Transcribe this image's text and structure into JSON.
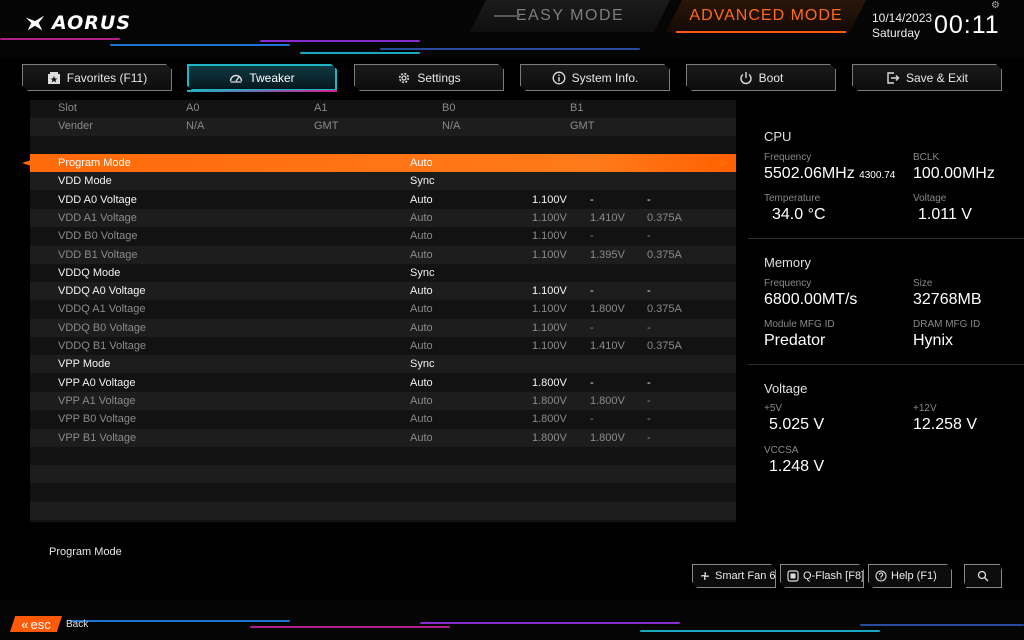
{
  "header": {
    "brand": "AORUS",
    "easy_mode": "EASY MODE",
    "advanced_mode": "ADVANCED MODE",
    "date": "10/14/2023",
    "day": "Saturday",
    "time": "00:11"
  },
  "tabs": [
    {
      "label": "Favorites (F11)",
      "icon": "favorites-icon"
    },
    {
      "label": "Tweaker",
      "icon": "gauge-icon",
      "active": true
    },
    {
      "label": "Settings",
      "icon": "gear-icon"
    },
    {
      "label": "System Info.",
      "icon": "info-icon"
    },
    {
      "label": "Boot",
      "icon": "power-icon"
    },
    {
      "label": "Save & Exit",
      "icon": "exit-icon"
    }
  ],
  "slot_table": {
    "slot": {
      "label": "Slot",
      "values": [
        "A0",
        "A1",
        "B0",
        "B1"
      ]
    },
    "vender": {
      "label": "Vender",
      "values": [
        "N/A",
        "GMT",
        "N/A",
        "GMT"
      ]
    }
  },
  "settings": [
    {
      "name": "Program Mode",
      "value": "Auto",
      "v1": "",
      "v2": "",
      "v3": "",
      "style": "selected"
    },
    {
      "name": "VDD Mode",
      "value": "Sync",
      "v1": "",
      "v2": "",
      "v3": "",
      "style": "bright"
    },
    {
      "name": "VDD A0 Voltage",
      "value": "Auto",
      "v1": "1.100V",
      "v2": "-",
      "v3": "-",
      "style": "bright"
    },
    {
      "name": "VDD A1 Voltage",
      "value": "Auto",
      "v1": "1.100V",
      "v2": "1.410V",
      "v3": "0.375A",
      "style": "dim"
    },
    {
      "name": "VDD B0 Voltage",
      "value": "Auto",
      "v1": "1.100V",
      "v2": "-",
      "v3": "-",
      "style": "dim"
    },
    {
      "name": "VDD B1 Voltage",
      "value": "Auto",
      "v1": "1.100V",
      "v2": "1.395V",
      "v3": "0.375A",
      "style": "dim"
    },
    {
      "name": "VDDQ Mode",
      "value": "Sync",
      "v1": "",
      "v2": "",
      "v3": "",
      "style": "bright"
    },
    {
      "name": "VDDQ A0 Voltage",
      "value": "Auto",
      "v1": "1.100V",
      "v2": "-",
      "v3": "-",
      "style": "bright"
    },
    {
      "name": "VDDQ A1 Voltage",
      "value": "Auto",
      "v1": "1.100V",
      "v2": "1.800V",
      "v3": "0.375A",
      "style": "dim"
    },
    {
      "name": "VDDQ B0 Voltage",
      "value": "Auto",
      "v1": "1.100V",
      "v2": "-",
      "v3": "-",
      "style": "dim"
    },
    {
      "name": "VDDQ B1 Voltage",
      "value": "Auto",
      "v1": "1.100V",
      "v2": "1.410V",
      "v3": "0.375A",
      "style": "dim"
    },
    {
      "name": "VPP Mode",
      "value": "Sync",
      "v1": "",
      "v2": "",
      "v3": "",
      "style": "bright"
    },
    {
      "name": "VPP A0 Voltage",
      "value": "Auto",
      "v1": "1.800V",
      "v2": "-",
      "v3": "-",
      "style": "bright"
    },
    {
      "name": "VPP A1 Voltage",
      "value": "Auto",
      "v1": "1.800V",
      "v2": "1.800V",
      "v3": "-",
      "style": "dim"
    },
    {
      "name": "VPP B0 Voltage",
      "value": "Auto",
      "v1": "1.800V",
      "v2": "-",
      "v3": "-",
      "style": "dim"
    },
    {
      "name": "VPP B1 Voltage",
      "value": "Auto",
      "v1": "1.800V",
      "v2": "1.800V",
      "v3": "-",
      "style": "dim"
    }
  ],
  "panel": {
    "cpu": {
      "title": "CPU",
      "frequency_label": "Frequency",
      "frequency": "5502.06MHz",
      "frequency_sub": "4300.74",
      "bclk_label": "BCLK",
      "bclk": "100.00MHz",
      "temperature_label": "Temperature",
      "temperature": "34.0 °C",
      "voltage_label": "Voltage",
      "voltage": "1.011 V"
    },
    "memory": {
      "title": "Memory",
      "frequency_label": "Frequency",
      "frequency": "6800.00MT/s",
      "size_label": "Size",
      "size": "32768MB",
      "module_label": "Module MFG ID",
      "module": "Predator",
      "dram_label": "DRAM MFG ID",
      "dram": "Hynix"
    },
    "voltage": {
      "title": "Voltage",
      "v5_label": "+5V",
      "v5": "5.025 V",
      "v12_label": "+12V",
      "v12": "12.258 V",
      "vccsa_label": "VCCSA",
      "vccsa": "1.248 V"
    }
  },
  "help_text": "Program Mode",
  "bottom_buttons": {
    "smart_fan": "Smart Fan 6 [F",
    "qflash": "Q-Flash [F8]",
    "help": "Help (F1)"
  },
  "footer": {
    "esc": "esc",
    "back": "Back"
  },
  "colors": {
    "accent_orange": "#ff6a1a",
    "accent_cyan": "#1fb5c6",
    "accent_magenta": "#d1208f"
  }
}
